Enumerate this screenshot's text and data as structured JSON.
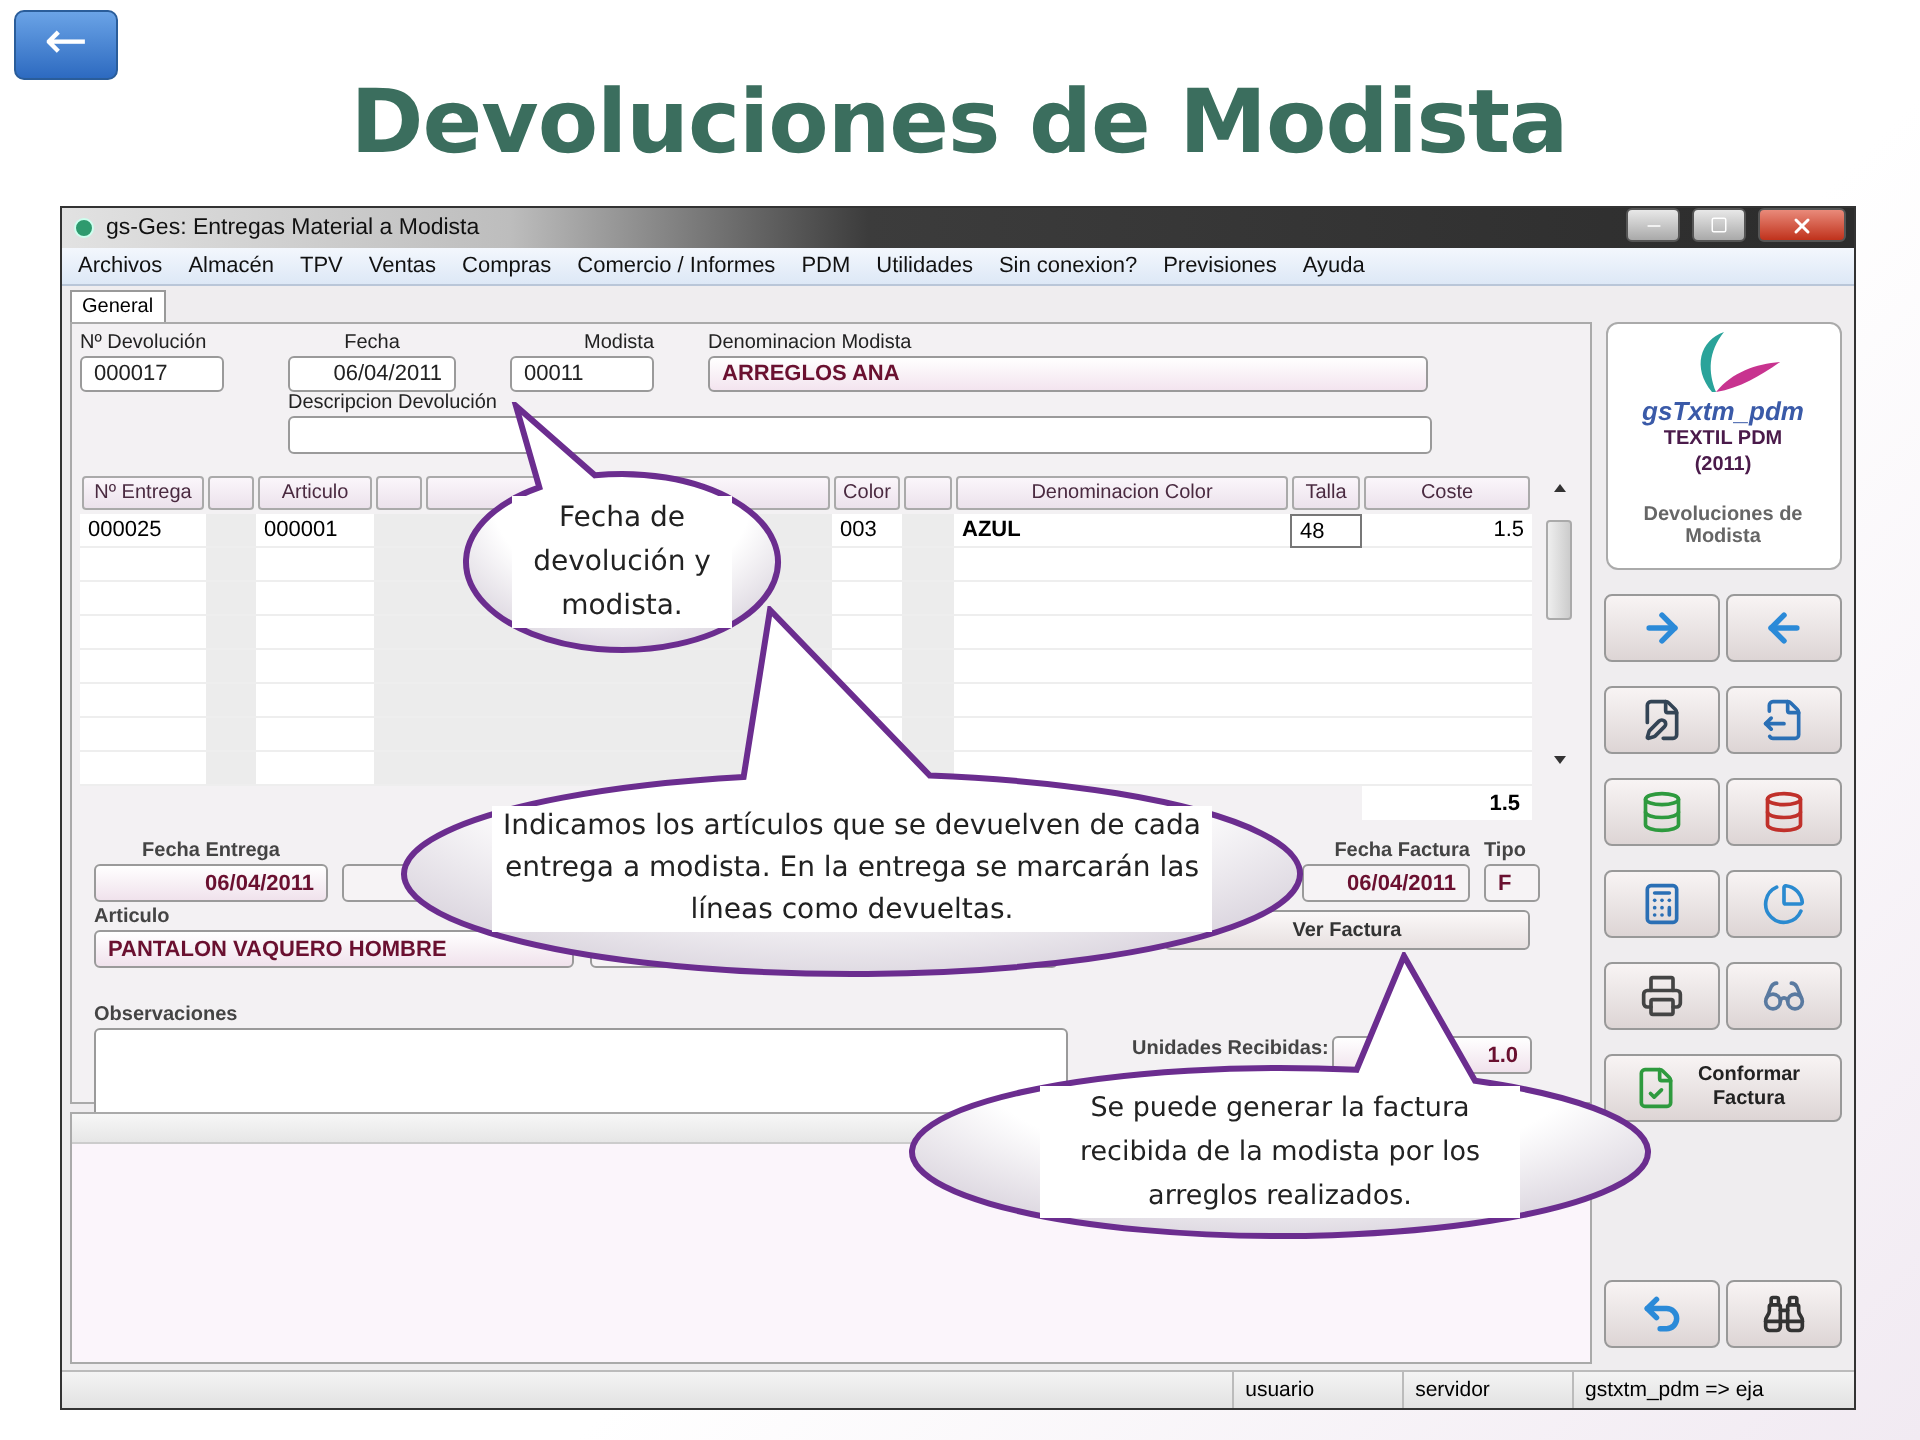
{
  "back_button": {
    "label": "←"
  },
  "title": "Devoluciones de Modista",
  "window": {
    "title": "gs-Ges: Entregas Material a Modista"
  },
  "menu": [
    "Archivos",
    "Almacén",
    "TPV",
    "Ventas",
    "Compras",
    "Comercio / Informes",
    "PDM",
    "Utilidades",
    "Sin conexion?",
    "Previsiones",
    "Ayuda"
  ],
  "tabs": [
    {
      "label": "General",
      "selected": true
    }
  ],
  "header_fields": [
    {
      "label": "Nº Devolución",
      "value": "000017",
      "kind": "plain"
    },
    {
      "label": "Fecha",
      "value": "06/04/2011",
      "kind": "date"
    },
    {
      "label": "Modista",
      "value": "00011",
      "kind": "plain"
    },
    {
      "label": "Denominacion Modista",
      "value": "ARREGLOS ANA",
      "kind": "name"
    }
  ],
  "description_field": {
    "label": "Descripcion Devolución"
  },
  "table": {
    "columns": [
      {
        "kind": "text",
        "label": "Nº Entrega"
      },
      {
        "kind": "blank"
      },
      {
        "kind": "text",
        "label": "Articulo"
      },
      {
        "kind": "blank"
      },
      {
        "kind": "blank"
      },
      {
        "kind": "text",
        "label": "Color"
      },
      {
        "kind": "blank"
      },
      {
        "kind": "text",
        "label": "Denominacion Color"
      },
      {
        "kind": "text",
        "label": "Talla"
      },
      {
        "kind": "text",
        "label": "Coste"
      }
    ],
    "rows": [
      {
        "cells": [
          "000025",
          "",
          "000001",
          "",
          "",
          "003",
          "",
          "AZUL",
          "48",
          "1.5"
        ]
      }
    ],
    "total": "1.5"
  },
  "detail": {
    "fecha_entrega": {
      "label": "Fecha Entrega",
      "value": "06/04/2011"
    },
    "articulo": {
      "label": "Articulo",
      "value": "PANTALON VAQUERO HOMBRE"
    },
    "fecha_factura": {
      "label": "Fecha Factura",
      "value": "06/04/2011"
    },
    "tipo": {
      "label": "Tipo",
      "value": "F"
    },
    "ver_factura": {
      "label": "Ver Factura"
    },
    "observaciones": {
      "label": "Observaciones"
    },
    "unidades": {
      "label": "Unidades Recibidas:",
      "value": "1.0"
    }
  },
  "sidebar": {
    "logo_text": "gsTxtm_pdm",
    "product": "TEXTIL PDM",
    "year": "(2011)",
    "caption": "Devoluciones de Modista",
    "conformar": "Conformar Factura"
  },
  "status_bar": [
    "usuario",
    "servidor",
    "gstxtm_pdm => eja"
  ],
  "callouts": [
    {
      "text": "Fecha de devolución y modista."
    },
    {
      "text": "Indicamos los artículos que se devuelven de cada entrega a modista. En la entrega se marcarán las líneas como devueltas."
    },
    {
      "text": "Se puede generar la factura recibida de la modista por los arreglos realizados."
    }
  ]
}
